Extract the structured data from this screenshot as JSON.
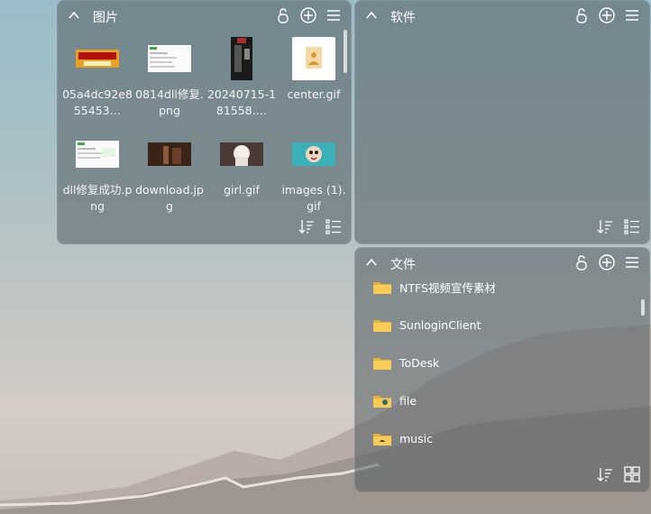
{
  "panels": {
    "tupian": {
      "title": "图片",
      "items": [
        {
          "label": "05a4dc92e855453…",
          "icon": "image-thumb"
        },
        {
          "label": "0814dll修复.png",
          "icon": "image-thumb"
        },
        {
          "label": "20240715-181558.…",
          "icon": "image-thumb"
        },
        {
          "label": "center.gif",
          "icon": "gif-file-icon"
        },
        {
          "label": "dll修复成功.png",
          "icon": "image-thumb"
        },
        {
          "label": "download.jpg",
          "icon": "image-thumb"
        },
        {
          "label": "girl.gif",
          "icon": "image-thumb"
        },
        {
          "label": "images (1).gif",
          "icon": "image-thumb"
        }
      ]
    },
    "ruanjian": {
      "title": "软件",
      "items": []
    },
    "wenjian": {
      "title": "文件",
      "items": [
        {
          "label": "NTFS视频宣传素材",
          "icon": "folder-icon"
        },
        {
          "label": "SunloginClient",
          "icon": "folder-icon"
        },
        {
          "label": "ToDesk",
          "icon": "folder-icon"
        },
        {
          "label": "file",
          "icon": "folder-icon"
        },
        {
          "label": "music",
          "icon": "folder-icon"
        }
      ]
    }
  },
  "colors": {
    "panel": "#5a646a",
    "folder": "#f5c44a",
    "accent_orange": "#f0a020",
    "accent_green": "#3aa84a"
  }
}
